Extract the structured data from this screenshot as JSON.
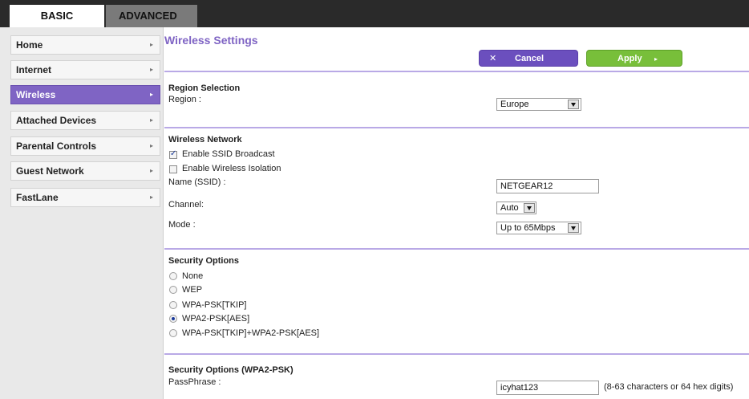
{
  "tabs": {
    "basic": "BASIC",
    "advanced": "ADVANCED"
  },
  "sidebar": {
    "items": [
      {
        "label": "Home",
        "arrow": "▸"
      },
      {
        "label": "Internet",
        "arrow": "▸"
      },
      {
        "label": "Wireless",
        "arrow": "▸"
      },
      {
        "label": "Attached Devices",
        "arrow": "▸"
      },
      {
        "label": "Parental Controls",
        "arrow": "▸"
      },
      {
        "label": "Guest Network",
        "arrow": "▸"
      },
      {
        "label": "FastLane",
        "arrow": "▸"
      }
    ],
    "active": "Wireless"
  },
  "main": {
    "title": "Wireless Settings",
    "cancel_label": "Cancel",
    "cancel_icon": "✕",
    "apply_label": "Apply",
    "apply_icon": "▸",
    "accent": "#7f64c4",
    "apply_color": "#78bf3a"
  },
  "region": {
    "heading": "Region Selection",
    "label": "Region :",
    "value": "Europe"
  },
  "wireless": {
    "heading": "Wireless Network",
    "ssid_broadcast": {
      "label": "Enable SSID Broadcast",
      "checked": true
    },
    "isolation": {
      "label": "Enable Wireless Isolation",
      "checked": false
    },
    "name_label": "Name (SSID) :",
    "name_value": "NETGEAR12",
    "channel_label": "Channel:",
    "channel_value": "Auto",
    "mode_label": "Mode :",
    "mode_value": "Up to 65Mbps"
  },
  "security": {
    "heading": "Security Options",
    "options": [
      {
        "label": "None",
        "selected": false
      },
      {
        "label": "WEP",
        "selected": false
      },
      {
        "label": "WPA-PSK[TKIP]",
        "selected": false
      },
      {
        "label": "WPA2-PSK[AES]",
        "selected": true
      },
      {
        "label": "WPA-PSK[TKIP]+WPA2-PSK[AES]",
        "selected": false
      }
    ]
  },
  "wpa2": {
    "heading": "Security Options (WPA2-PSK)",
    "passphrase_label": "PassPhrase :",
    "passphrase_value": "icyhat123",
    "hint": "(8-63 characters or 64 hex digits)"
  }
}
